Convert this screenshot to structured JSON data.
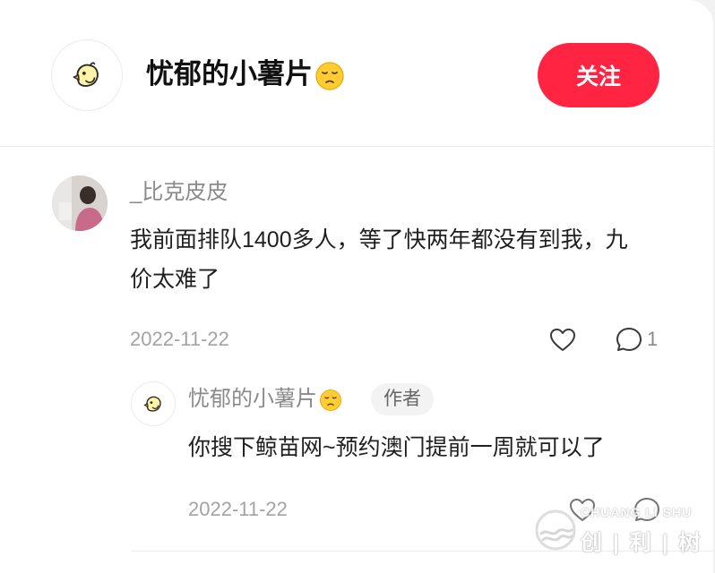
{
  "header": {
    "name": "忧郁的小薯片",
    "follow_label": "关注",
    "avatar_icon": "chick-icon",
    "accent": "#ff2442"
  },
  "comment": {
    "username": "_比克皮皮",
    "text": "我前面排队1400多人，等了快两年都没有到我，九价太难了",
    "date": "2022-11-22",
    "reply_count": "1",
    "like_icon": "heart-icon",
    "reply_icon": "speech-bubble-icon"
  },
  "reply": {
    "username": "忧郁的小薯片",
    "badge": "作者",
    "text": "你搜下鲸苗网~预约澳门提前一周就可以了",
    "date": "2022-11-22"
  },
  "watermark": {
    "en": "CHUANG LI SHU",
    "cn": "创|利|树"
  }
}
